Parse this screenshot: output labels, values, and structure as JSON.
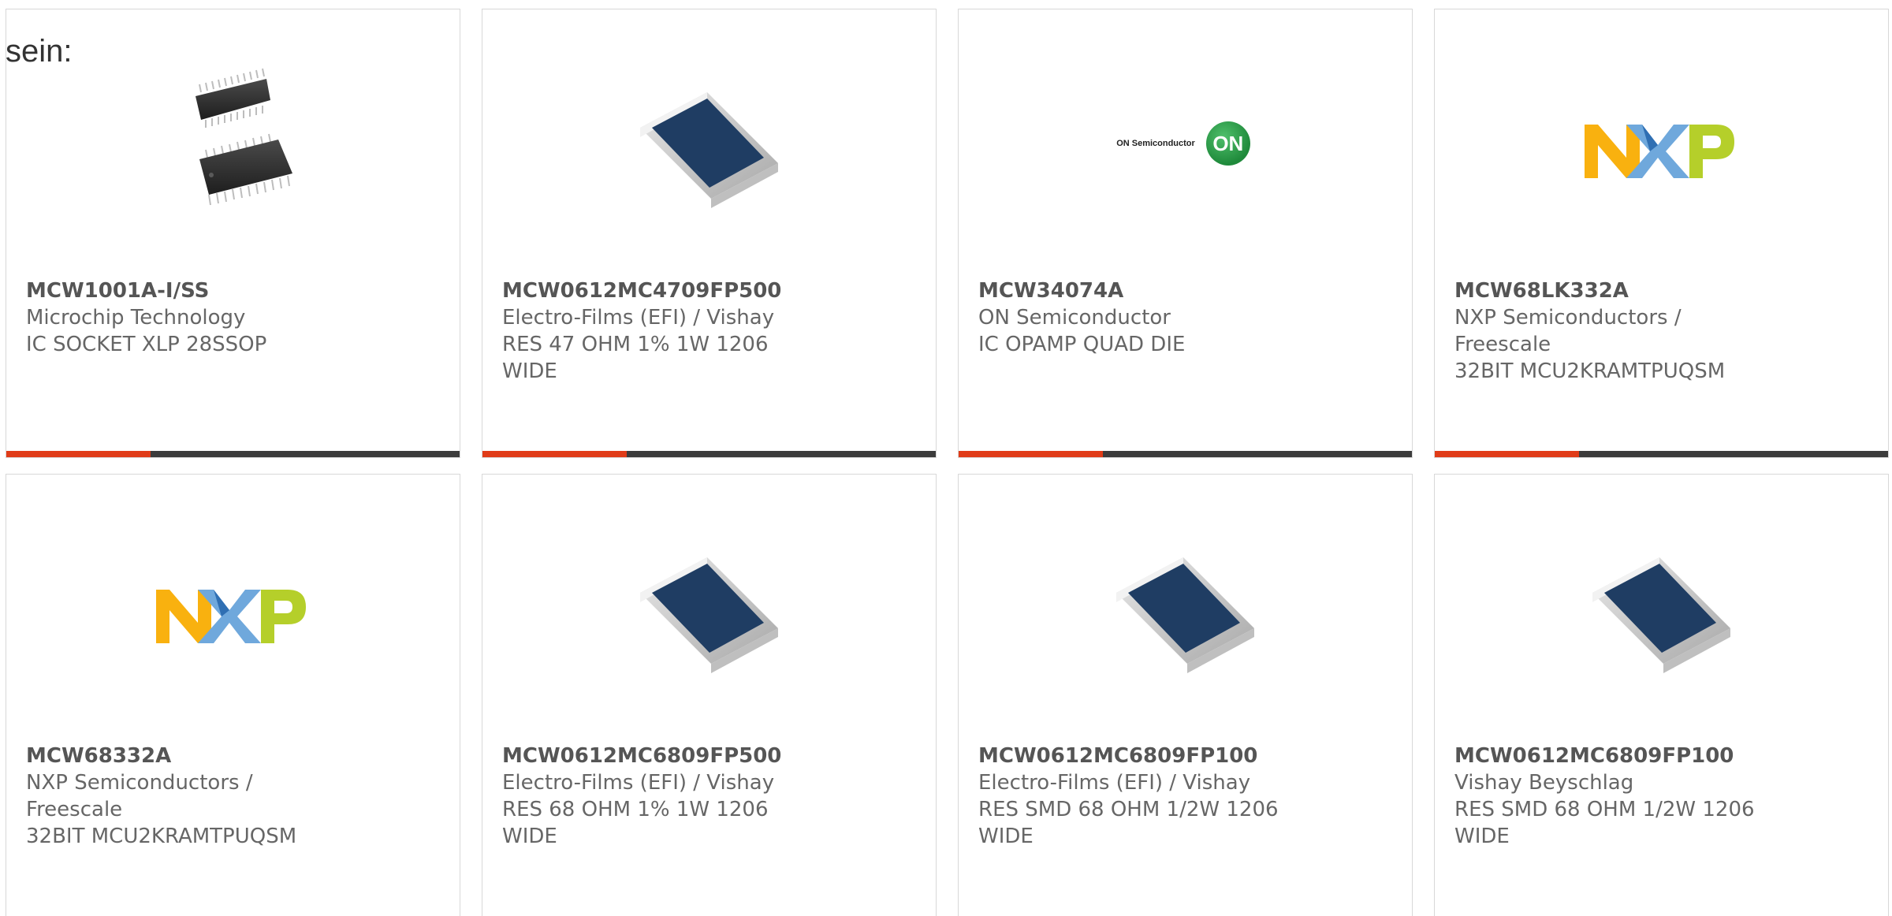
{
  "intro_text": "sein:",
  "colors": {
    "accent": "#e03c18",
    "bar": "#3c3c3c",
    "text": "#666666"
  },
  "products": [
    {
      "part": "MCW1001A-I/SS",
      "manufacturer": "Microchip Technology",
      "description": "IC SOCKET XLP 28SSOP",
      "image": "ic-chip-image"
    },
    {
      "part": "MCW0612MC4709FP500",
      "manufacturer": "Electro-Films (EFI) / Vishay",
      "description": "RES 47 OHM 1% 1W 1206 WIDE",
      "image": "resistor-image"
    },
    {
      "part": "MCW34074A",
      "manufacturer": "ON Semiconductor",
      "description": "IC OPAMP QUAD DIE",
      "image": "on-semiconductor-logo",
      "logo_text": "ON Semiconductor",
      "logo_mark": "ON"
    },
    {
      "part": "MCW68LK332A",
      "manufacturer": "NXP Semiconductors / Freescale",
      "description": "32BIT MCU2KRAMTPUQSM",
      "image": "nxp-logo"
    },
    {
      "part": "MCW68332A",
      "manufacturer": "NXP Semiconductors / Freescale",
      "description": "32BIT MCU2KRAMTPUQSM",
      "image": "nxp-logo"
    },
    {
      "part": "MCW0612MC6809FP500",
      "manufacturer": "Electro-Films (EFI) / Vishay",
      "description": "RES 68 OHM 1% 1W 1206 WIDE",
      "image": "resistor-image"
    },
    {
      "part": "MCW0612MC6809FP100",
      "manufacturer": "Electro-Films (EFI) / Vishay",
      "description": "RES SMD 68 OHM 1/2W 1206 WIDE",
      "image": "resistor-image"
    },
    {
      "part": "MCW0612MC6809FP100",
      "manufacturer": "Vishay Beyschlag",
      "description": "RES SMD 68 OHM 1/2W 1206 WIDE",
      "image": "resistor-image"
    }
  ]
}
